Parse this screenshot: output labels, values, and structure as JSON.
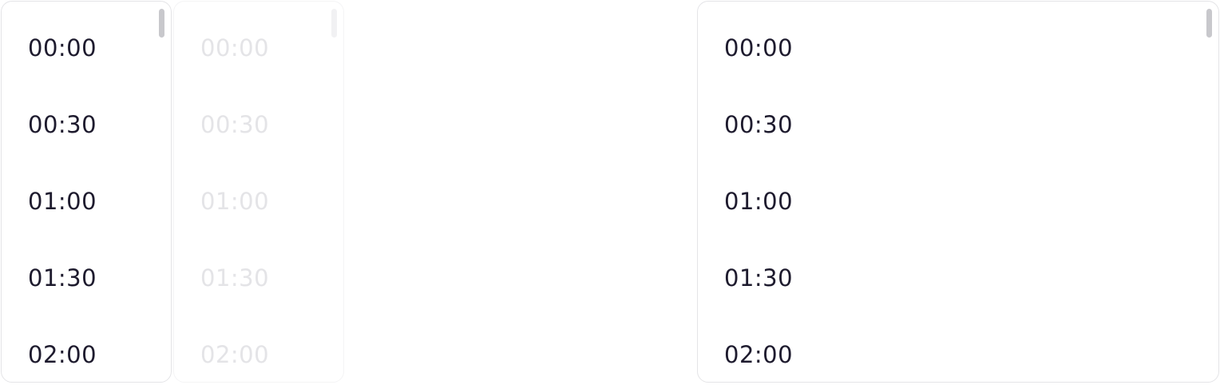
{
  "lists": [
    {
      "id": "default",
      "state": "enabled",
      "options": [
        "00:00",
        "00:30",
        "01:00",
        "01:30",
        "02:00"
      ]
    },
    {
      "id": "disabled",
      "state": "disabled",
      "options": [
        "00:00",
        "00:30",
        "01:00",
        "01:30",
        "02:00"
      ]
    },
    {
      "id": "full-width",
      "state": "enabled",
      "options": [
        "00:00",
        "00:30",
        "01:00",
        "01:30",
        "02:00"
      ]
    }
  ],
  "colors": {
    "text": "#1e1b2e",
    "text_disabled": "#e4e4e7",
    "border": "#e4e4e7",
    "scrollbar": "#c8c8cc"
  }
}
